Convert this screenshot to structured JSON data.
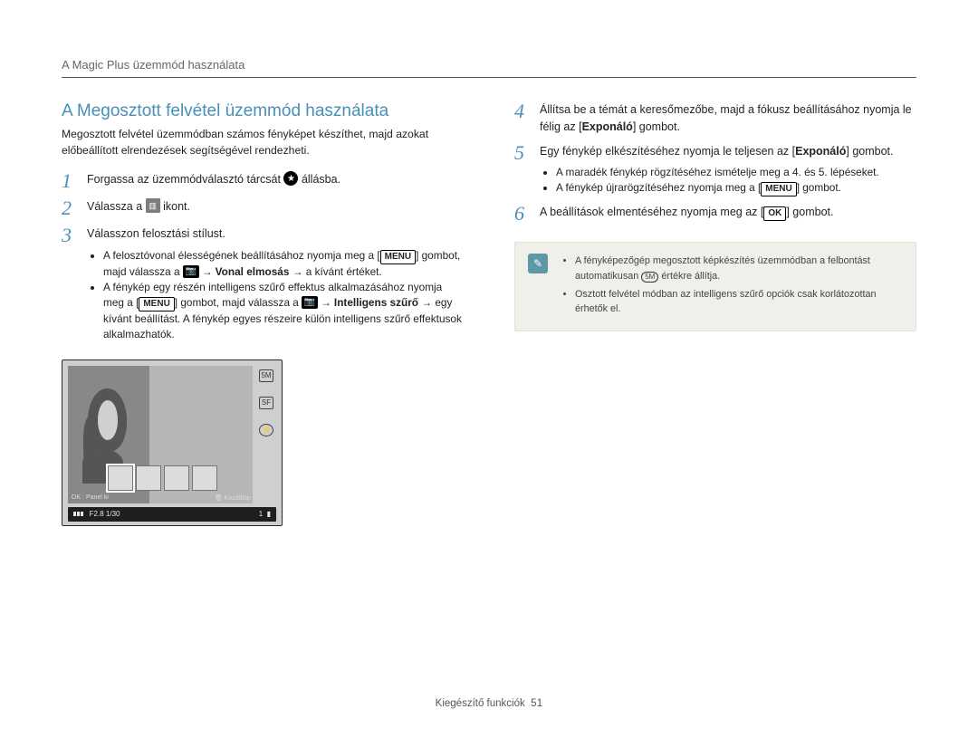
{
  "header": {
    "running_title": "A Magic Plus üzemmód használata"
  },
  "title": "A Megosztott felvétel üzemmód használata",
  "intro": "Megosztott felvétel üzemmódban számos fényképet készíthet, majd azokat előbeállított elrendezések segítségével rendezheti.",
  "icons": {
    "star": "★",
    "split": "▥",
    "menu": "MENU",
    "ok": "OK",
    "camera": "📷"
  },
  "steps_left": {
    "s1_a": "Forgassa az üzemmódválasztó tárcsát ",
    "s1_b": " állásba.",
    "s2_a": "Válassza a ",
    "s2_b": " ikont.",
    "s3": "Válasszon felosztási stílust.",
    "s3_sub": {
      "b1_a": "A felosztóvonal élességének beállításához nyomja meg a [",
      "b1_b": "] gombot, majd válassza a ",
      "b1_c": " → ",
      "b1_bold": "Vonal elmosás",
      "b1_d": " → a kívánt értéket.",
      "b2_a": "A fénykép egy részén intelligens szűrő effektus alkalmazásához nyomja meg a [",
      "b2_b": "] gombot, majd válassza a ",
      "b2_c": " → ",
      "b2_bold": "Intelligens szűrő",
      "b2_d": " → egy kívánt beállítást. A fénykép egyes részeire külön intelligens szűrő effektusok alkalmazhatók."
    }
  },
  "steps_right": {
    "s4": "Állítsa be a témát a keresőmezőbe, majd a fókusz beállításához nyomja le félig az [",
    "s4_bold": "Exponáló",
    "s4_end": "] gombot.",
    "s5": "Egy fénykép elkészítéséhez nyomja le teljesen az [",
    "s5_bold": "Exponáló",
    "s5_end": "] gombot.",
    "s5_sub": {
      "b1": "A maradék fénykép rögzítéséhez ismételje meg a 4. és 5. lépéseket.",
      "b2_a": "A fénykép újrarögzítéséhez nyomja meg a [",
      "b2_b": "] gombot."
    },
    "s6_a": "A beállítások elmentéséhez nyomja meg az [",
    "s6_b": "] gombot."
  },
  "illustration": {
    "hint_left": "OK : Panel ki",
    "hint_right": "Kezdőlap",
    "status_left_fnum": "F2.8",
    "status_left_shutter": "1/30",
    "status_right_count": "1"
  },
  "note": {
    "items": [
      {
        "a": "A fényképezőgép megosztott képkészítés üzemmódban a felbontást automatikusan ",
        "res": "5M",
        "b": " értékre állítja."
      },
      {
        "a": "Osztott felvétel módban az intelligens szűrő opciók csak korlátozottan érhetők el."
      }
    ]
  },
  "footer": {
    "section": "Kiegészítő funkciók",
    "page": "51"
  }
}
